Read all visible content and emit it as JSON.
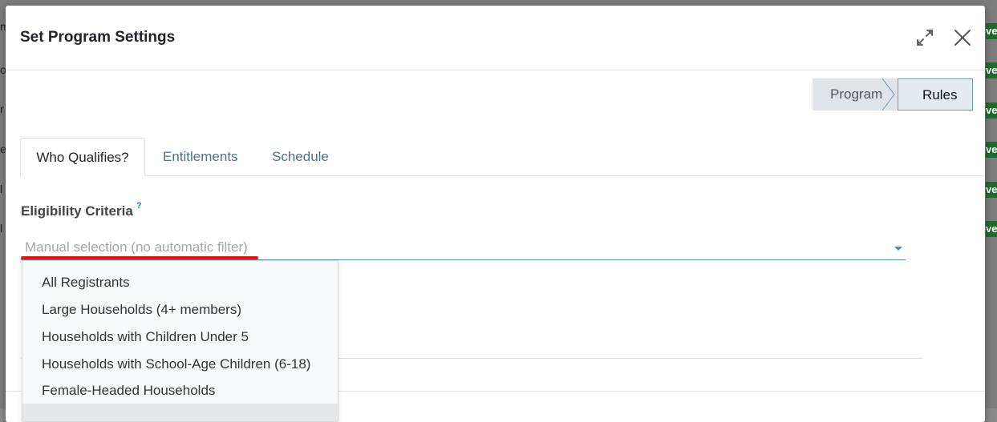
{
  "background": {
    "edge_letters": [
      "m",
      "o",
      "r",
      "e",
      "l",
      "l"
    ],
    "badge_text": "ve"
  },
  "modal": {
    "title": "Set Program Settings",
    "expand_icon": "expand-icon",
    "close_icon": "close-icon"
  },
  "statusbar": {
    "stages": [
      "Program",
      "Rules"
    ],
    "active": "Rules"
  },
  "tabs": [
    "Who Qualifies?",
    "Entitlements",
    "Schedule"
  ],
  "active_tab": "Who Qualifies?",
  "eligibility": {
    "label": "Eligibility Criteria",
    "help": "?",
    "placeholder": "Manual selection (no automatic filter)"
  },
  "dropdown_options": [
    "All Registrants",
    "Large Households (4+ members)",
    "Households with Children Under 5",
    "Households with School-Age Children (6-18)",
    "Female-Headed Households"
  ],
  "colors": {
    "link_tab": "#4f7185",
    "underline_highlight": "#ee1111",
    "badge": "#1f6b2e"
  }
}
